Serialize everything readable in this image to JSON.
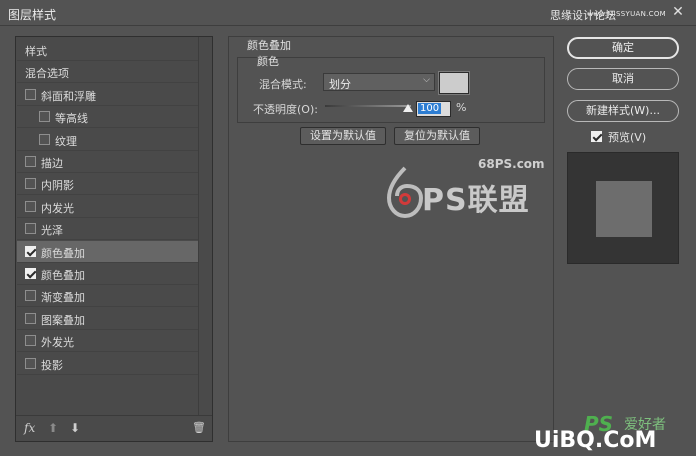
{
  "window": {
    "title": "图层样式",
    "watermark": "思缘设计论坛",
    "watermark_site": "www.MISSYUAN.COM",
    "close": "✕"
  },
  "left_panel": {
    "items": [
      {
        "label": "样式",
        "checkbox": false,
        "checked": false,
        "plus": false,
        "selected": false
      },
      {
        "label": "混合选项",
        "checkbox": false,
        "checked": false,
        "plus": false,
        "selected": false
      },
      {
        "label": "斜面和浮雕",
        "checkbox": true,
        "checked": false,
        "plus": false,
        "selected": false
      },
      {
        "label": "等高线",
        "checkbox": true,
        "checked": false,
        "plus": false,
        "selected": false,
        "indent": true
      },
      {
        "label": "纹理",
        "checkbox": true,
        "checked": false,
        "plus": false,
        "selected": false,
        "indent": true
      },
      {
        "label": "描边",
        "checkbox": true,
        "checked": false,
        "plus": true,
        "selected": false
      },
      {
        "label": "内阴影",
        "checkbox": true,
        "checked": false,
        "plus": true,
        "selected": false
      },
      {
        "label": "内发光",
        "checkbox": true,
        "checked": false,
        "plus": false,
        "selected": false
      },
      {
        "label": "光泽",
        "checkbox": true,
        "checked": false,
        "plus": false,
        "selected": false
      },
      {
        "label": "颜色叠加",
        "checkbox": true,
        "checked": true,
        "plus": true,
        "selected": true
      },
      {
        "label": "颜色叠加",
        "checkbox": true,
        "checked": true,
        "plus": true,
        "selected": false
      },
      {
        "label": "渐变叠加",
        "checkbox": true,
        "checked": false,
        "plus": true,
        "selected": false
      },
      {
        "label": "图案叠加",
        "checkbox": true,
        "checked": false,
        "plus": false,
        "selected": false
      },
      {
        "label": "外发光",
        "checkbox": true,
        "checked": false,
        "plus": false,
        "selected": false
      },
      {
        "label": "投影",
        "checkbox": true,
        "checked": false,
        "plus": true,
        "selected": false
      }
    ],
    "footer": {
      "fx": "fx",
      "up": "⬆",
      "down": "⬇",
      "trash": "🗑"
    }
  },
  "center": {
    "group_title": "颜色叠加",
    "sub_title": "颜色",
    "blend_label": "混合模式:",
    "blend_value": "划分",
    "blend_arrow": "⌵",
    "overlay_color": "#cccccc",
    "opacity_label": "不透明度(O):",
    "opacity_value": "100",
    "opacity_unit": "%",
    "set_default": "设置为默认值",
    "reset_default": "复位为默认值"
  },
  "logo": {
    "site": "68PS.com",
    "text": "PS联盟"
  },
  "right": {
    "ok": "确定",
    "cancel": "取消",
    "new_style": "新建样式(W)...",
    "preview_label": "预览(V)",
    "preview_checked": true
  },
  "bottom_watermark": {
    "ps": "PS",
    "cn": "爱好者",
    "url": "UiBQ.CoM"
  }
}
